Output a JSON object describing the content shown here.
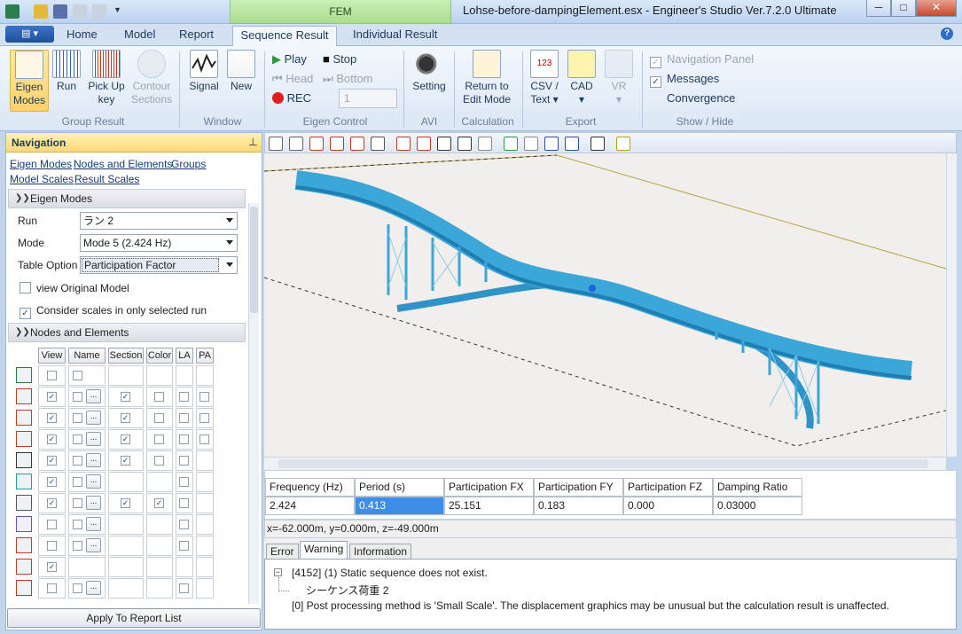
{
  "window": {
    "title": "Lohse-before-dampingElement.esx - Engineer's Studio Ver.7.2.0 Ultimate",
    "context_tab": "FEM",
    "controls": {
      "minimize": "─",
      "maximize": "□",
      "close": "✕"
    }
  },
  "tabs": [
    {
      "label": "Home"
    },
    {
      "label": "Model"
    },
    {
      "label": "Report"
    },
    {
      "label": "Sequence Result",
      "active": true
    },
    {
      "label": "Individual Result"
    }
  ],
  "ribbon": {
    "group_result": {
      "label": "Group Result",
      "buttons": [
        {
          "label": "Eigen Modes",
          "selected": true
        },
        {
          "label": "Run"
        },
        {
          "label": "Pick Up key"
        },
        {
          "label": "Contour Sections",
          "disabled": true
        }
      ]
    },
    "window": {
      "label": "Window",
      "buttons": [
        {
          "label": "Signal"
        },
        {
          "label": "New"
        }
      ]
    },
    "eigen_control": {
      "label": "Eigen Control",
      "play": "Play",
      "stop": "Stop",
      "head": "Head",
      "bottom": "Bottom",
      "rec": "REC",
      "frame_value": "1"
    },
    "avi": {
      "label": "AVI",
      "setting": "Setting"
    },
    "calculation": {
      "label": "Calculation",
      "return": "Return to Edit Mode"
    },
    "export": {
      "label": "Export",
      "csv": "CSV / Text",
      "cad": "CAD",
      "vr": "VR"
    },
    "show_hide": {
      "label": "Show / Hide",
      "navigation_panel": "Navigation Panel",
      "messages": "Messages",
      "convergence": "Convergence"
    }
  },
  "navigation": {
    "title": "Navigation",
    "links": [
      "Eigen Modes",
      "Nodes and Elements",
      "Groups",
      "Model Scales",
      "Result Scales"
    ],
    "eigen_modes": {
      "header": "Eigen Modes",
      "run_label": "Run",
      "run_value": "ラン 2",
      "mode_label": "Mode",
      "mode_value": "Mode 5 (2.424 Hz)",
      "table_option_label": "Table Option",
      "table_option_value": "Participation Factor",
      "view_original": "view Original Model",
      "consider_scales": "Consider scales in only selected run"
    },
    "nodes_elements": {
      "header": "Nodes and Elements",
      "columns": [
        "View",
        "Name",
        "Section",
        "Color",
        "LA",
        "PA"
      ],
      "dots": "..."
    },
    "apply_button": "Apply To Report List"
  },
  "results": {
    "headers": [
      "Frequency (Hz)",
      "Period (s)",
      "Participation FX",
      "Participation FY",
      "Participation FZ",
      "Damping Ratio"
    ],
    "values": [
      "2.424",
      "0.413",
      "25.151",
      "0.183",
      "0.000",
      "0.03000"
    ]
  },
  "coordinates": "x=-62.000m, y=0.000m, z=-49.000m",
  "messages": {
    "tabs": [
      "Error",
      "Warning",
      "Information"
    ],
    "lines": [
      "[4152] (1) Static sequence does not exist.",
      "シーケンス荷重 2",
      "[0] Post processing method is 'Small Scale'. The displacement graphics may be unusual but the calculation result is unaffected."
    ]
  },
  "colors": {
    "structure": "#3ba6d8",
    "structure_dark": "#1f7fb3",
    "selection": "#3d8ee6",
    "ribbon_selected": "#ffd26a",
    "nav_header": "#ffd872"
  }
}
